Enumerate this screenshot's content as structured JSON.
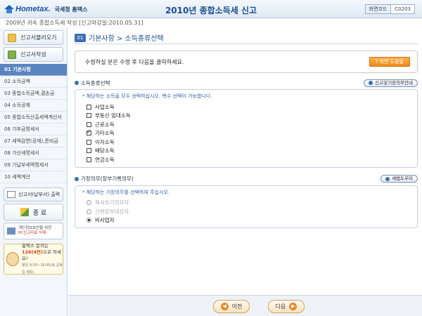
{
  "header": {
    "brand": "Hometax.",
    "org": "국세청 홈택스",
    "title": "2010년 종합소득세 신고",
    "screen_code_label": "화면코드",
    "screen_code": "C0203"
  },
  "subheader": "2009년 귀속 종합소득세 작성 [신고마감일:2010.05.31]",
  "sidebar": {
    "load_label": "신고서불러오기",
    "write_label": "신고서작성",
    "nav": [
      {
        "label": "01 기본사항",
        "active": true
      },
      {
        "label": "02 소득금액"
      },
      {
        "label": "03 종합소득금액,결손금"
      },
      {
        "label": "04 소득공제"
      },
      {
        "label": "05 종합소득산출세액계산서"
      },
      {
        "label": "06 기부금명세서"
      },
      {
        "label": "07 세액감면(공제),준비금"
      },
      {
        "label": "08 가산세명세서"
      },
      {
        "label": "09 기납부세액명세서"
      },
      {
        "label": "10 세액계산"
      }
    ],
    "print_label": "신고서(납부서) 출력",
    "end_label": "종 료",
    "pc_line1": "개인정보보안을 위한",
    "pc_line2": "PC신고자료 삭제",
    "help_line1": "홈택스 문의는",
    "help_number": "126(4번)",
    "help_line2_suffix": "으로 하세요!",
    "help_hours": "평일 9:00~18:00(토,공휴일 제외)"
  },
  "main": {
    "step_no": "01",
    "title": "기본사항 > 소득종류선택",
    "notice": "수정하실 분은 수정 후 다음을 클릭하세요.",
    "help_button": "? 화면 도움말",
    "income_section": {
      "title": "소득종류선택",
      "side_button": "신고및기장의무안내",
      "hint": "* 해당하는 소득을 모두 선택하십시오. 복수 선택이 가능합니다.",
      "options": [
        {
          "label": "사업소득",
          "checked": false
        },
        {
          "label": "부동산 임대소득",
          "checked": false
        },
        {
          "label": "근로소득",
          "checked": false
        },
        {
          "label": "기타소득",
          "checked": true
        },
        {
          "label": "이자소득",
          "checked": false
        },
        {
          "label": "배당소득",
          "checked": false
        },
        {
          "label": "연금소득",
          "checked": false
        }
      ]
    },
    "bookkeeping_section": {
      "title": "기장의무(장부기록의무)",
      "side_button": "세법도우미",
      "hint": "* 해당하는 기장의무를 선택하여 주십시오.",
      "options": [
        {
          "label": "복식부기의무자",
          "selected": false,
          "disabled": true
        },
        {
          "label": "간편장부대상자",
          "selected": false,
          "disabled": true
        },
        {
          "label": "비사업자",
          "selected": true,
          "disabled": false
        }
      ]
    }
  },
  "footer": {
    "prev_label": "이전",
    "next_label": "다음"
  }
}
